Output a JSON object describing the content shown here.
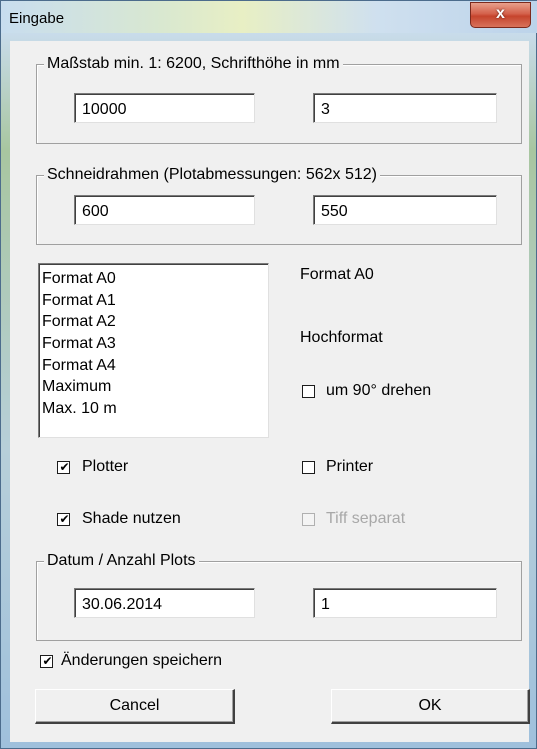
{
  "window": {
    "title": "Eingabe",
    "close_label": "x"
  },
  "scale_group": {
    "legend": "Maßstab min. 1:  6200, Schrifthöhe in mm",
    "scale_value": "10000",
    "font_height_value": "3"
  },
  "frame_group": {
    "legend": "Schneidrahmen (Plotabmessungen: 562x 512)",
    "width_value": "600",
    "height_value": "550"
  },
  "formats": {
    "items": [
      "Format A0",
      "Format A1",
      "Format A2",
      "Format A3",
      "Format A4",
      "Maximum",
      "Max. 10 m"
    ],
    "selected_label": "Format A0",
    "orientation_label": "Hochformat",
    "rotate_label": "um 90° drehen",
    "rotate_checked": false
  },
  "output": {
    "plotter_label": "Plotter",
    "plotter_checked": true,
    "printer_label": "Printer",
    "printer_checked": false,
    "shade_label": "Shade nutzen",
    "shade_checked": true,
    "tiff_label": "Tiff separat",
    "tiff_checked": false,
    "tiff_enabled": false
  },
  "date_group": {
    "legend": "Datum / Anzahl Plots",
    "date_value": "30.06.2014",
    "count_value": "1"
  },
  "save_changes": {
    "label": "Änderungen speichern",
    "checked": true
  },
  "buttons": {
    "cancel_label": "Cancel",
    "ok_label": "OK"
  },
  "check_glyph": "✔"
}
